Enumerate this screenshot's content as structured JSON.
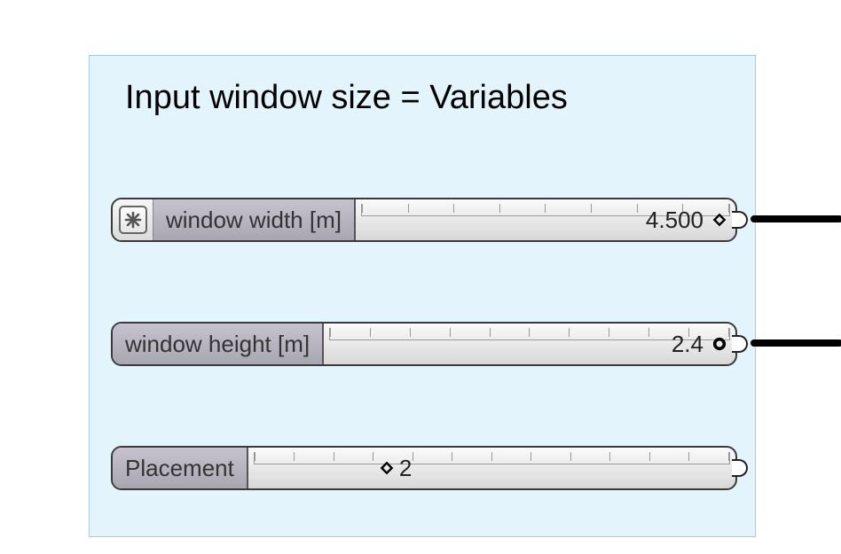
{
  "group": {
    "title": "Input window size = Variables"
  },
  "sliders": {
    "width": {
      "label": "window width [m]",
      "value": "4.500"
    },
    "height": {
      "label": "window height [m]",
      "value": "2.4"
    },
    "placement": {
      "label": "Placement",
      "value": "2"
    }
  }
}
